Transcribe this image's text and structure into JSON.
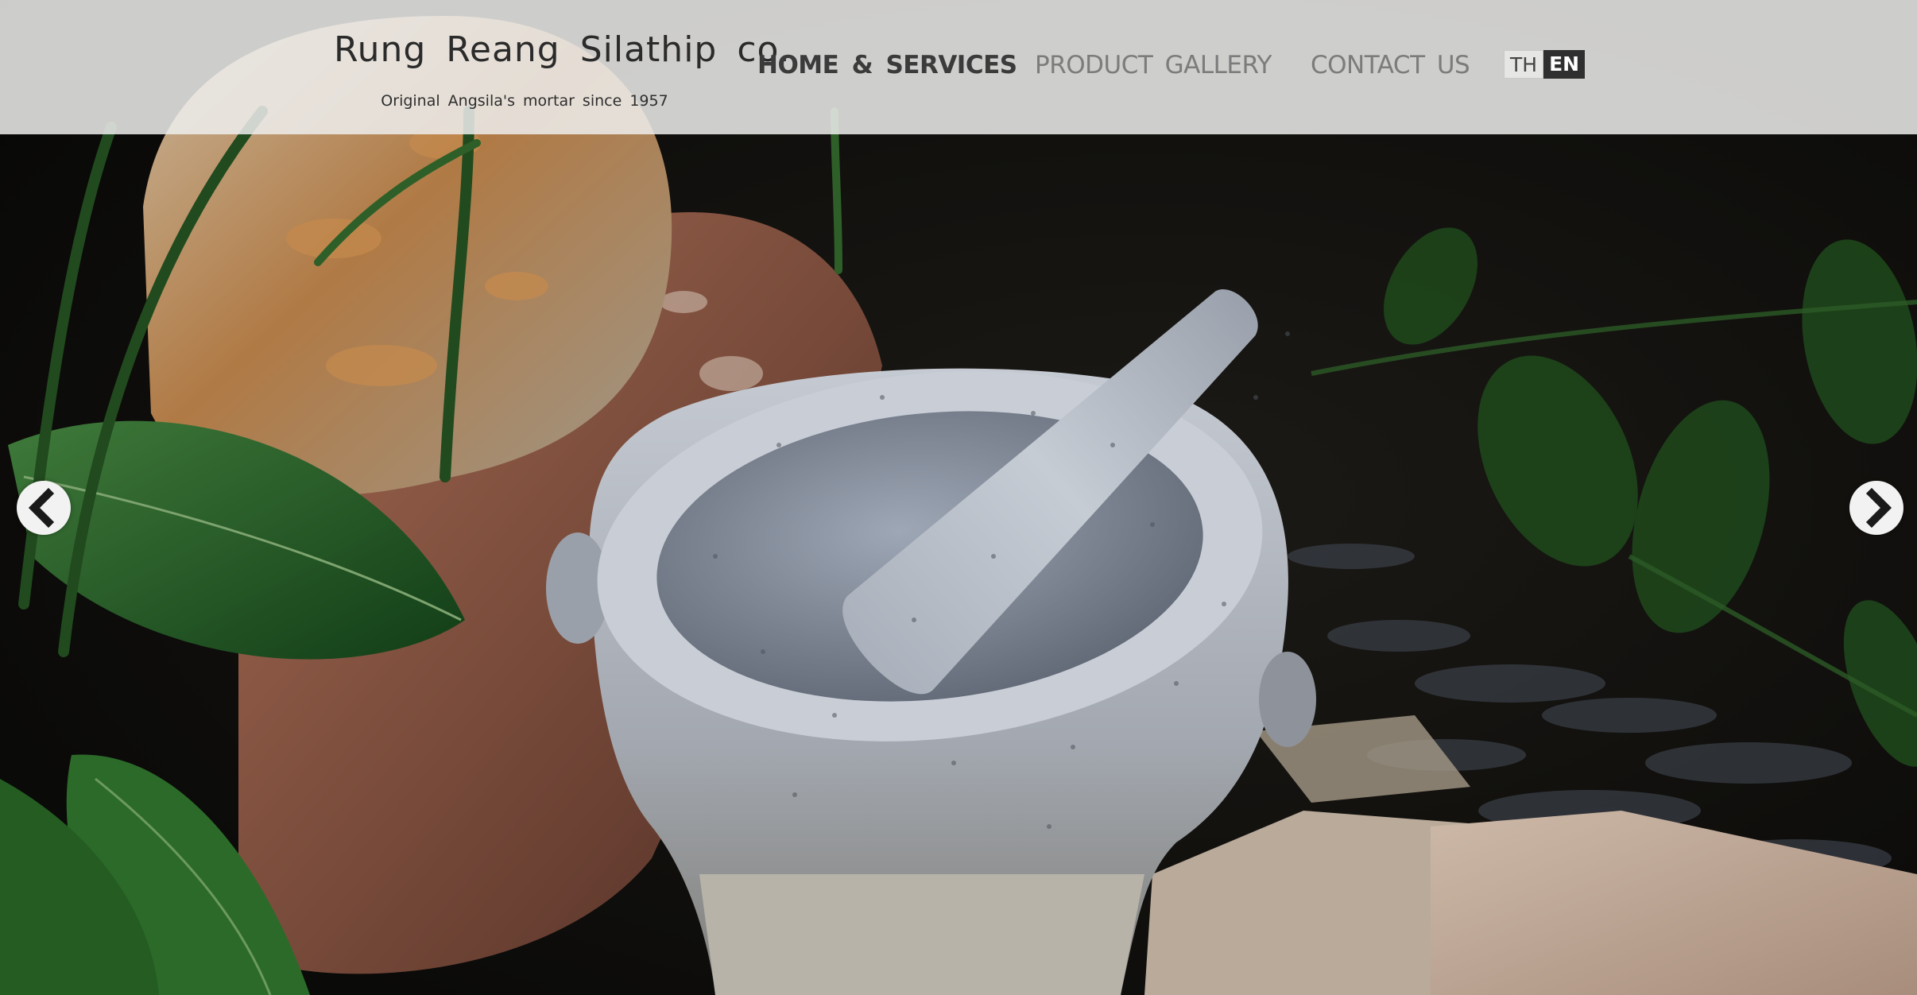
{
  "header": {
    "brand_title": "Rung Reang Silathip co.",
    "brand_tagline": "Original Angsila's mortar since 1957"
  },
  "nav": {
    "items": [
      {
        "label": "HOME & SERVICES",
        "active": true
      },
      {
        "label": "PRODUCT GALLERY",
        "active": false
      },
      {
        "label": "CONTACT US",
        "active": false
      }
    ]
  },
  "language": {
    "options": [
      "TH",
      "EN"
    ],
    "selected": "EN"
  },
  "carousel": {
    "prev_icon": "chevron-left-icon",
    "next_icon": "chevron-right-icon"
  },
  "colors": {
    "header_bg": "#eeeeec",
    "nav_active": "#3b3b3b",
    "nav_inactive": "#7c7c7c",
    "lang_selected_bg": "#2f2f2f"
  }
}
